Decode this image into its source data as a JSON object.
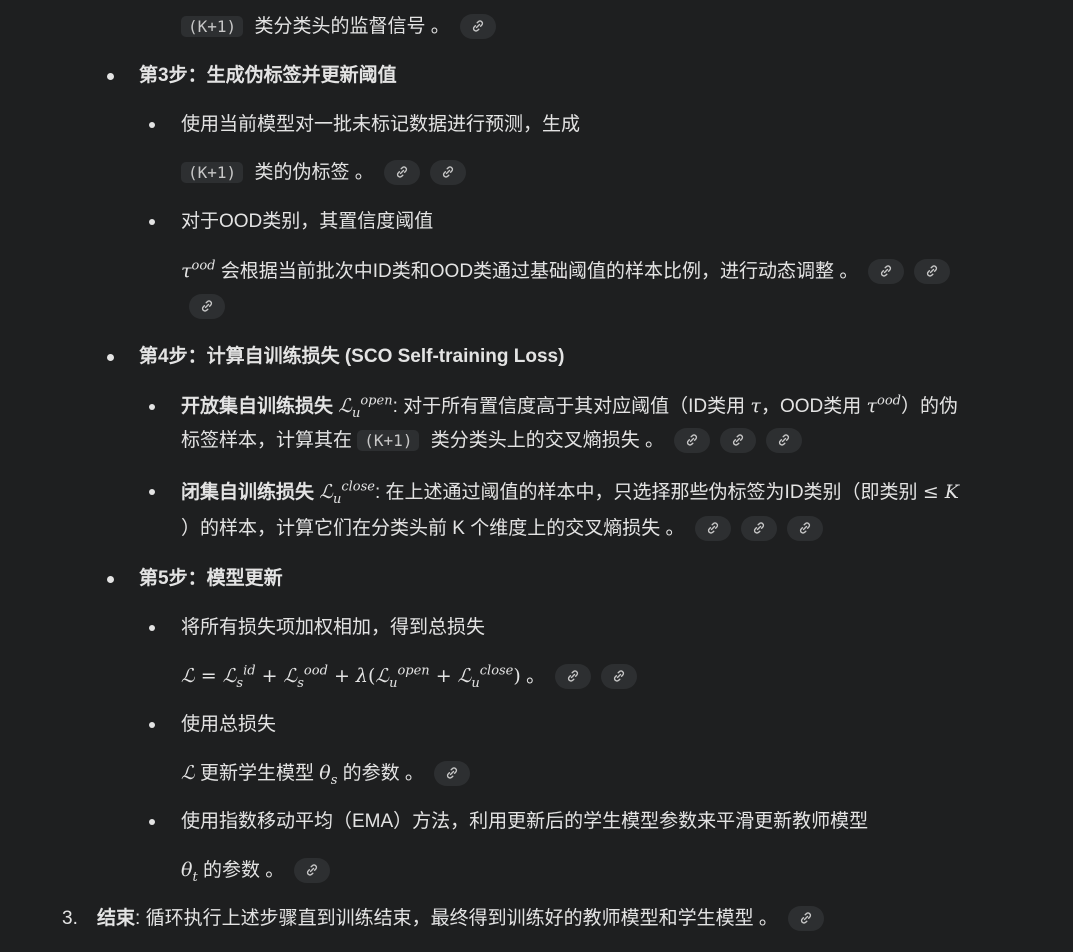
{
  "icons": {
    "link": "link-icon"
  },
  "colors": {
    "background": "#1e1f20",
    "text": "#e3e3e3",
    "chip": "#2d2f31"
  },
  "step2_tail": {
    "code": "(K+1)",
    "text": " 类分类头的监督信号 。"
  },
  "step3": {
    "title": "第3步：生成伪标签并更新阈值",
    "item1_line1": "使用当前模型对一批未标记数据进行预测，生成",
    "item1_code": "(K+1)",
    "item1_line2": " 类的伪标签 。",
    "item2_line1": "对于OOD类别，其置信度阈值",
    "item2_math": "τ",
    "item2_sup": "ood",
    "item2_line2": " 会根据当前批次中ID类和OOD类通过基础阈值的样本比例，进行动态调整 。"
  },
  "step4": {
    "title": "第4步：计算自训练损失 (SCO Self-training Loss)",
    "open_label": "开放集自训练损失",
    "open_sup": "open",
    "open_text_a": ": 对于所有置信度高于其对应阈值（ID类用 ",
    "open_tau": "τ",
    "open_text_b": "，OOD类用 ",
    "open_tau_ood_sup": "ood",
    "open_text_c": "）的伪",
    "open_line2_a": "标签样本，计算其在 ",
    "open_code": "(K+1)",
    "open_line2_b": " 类分类头上的交叉熵损失 。",
    "close_label": "闭集自训练损失",
    "close_sup": "close",
    "close_text_a": ": 在上述通过阈值的样本中，只选择那些伪标签为ID类别（即类别 ",
    "close_le": "≤ K",
    "close_line2": "）的样本，计算它们在分类头前 K 个维度上的交叉熵损失 。"
  },
  "step5": {
    "title": "第5步：模型更新",
    "item1_line1": "将所有损失项加权相加，得到总损失",
    "item1_formula_tail": " 。",
    "item2_line1": "使用总损失",
    "item2_line2": " 更新学生模型 ",
    "item2_theta_sub": "s",
    "item2_line2_tail": " 的参数 。",
    "item3_line1": "使用指数移动平均（EMA）方法，利用更新后的学生模型参数来平滑更新教师模型",
    "item3_theta_sub": "t",
    "item3_line2": " 的参数 。"
  },
  "end": {
    "number": "3.",
    "label": "结束",
    "text": ": 循环执行上述步骤直到训练结束，最终得到训练好的教师模型和学生模型 。"
  }
}
